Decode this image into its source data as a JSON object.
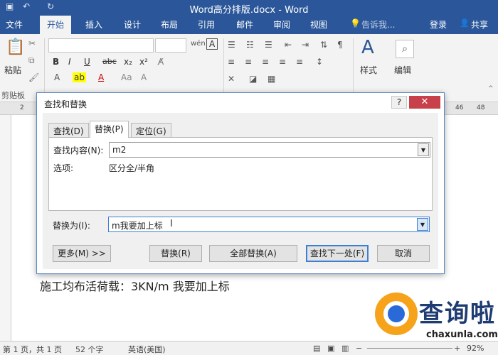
{
  "window": {
    "title": "Word高分排版.docx - Word"
  },
  "ribbon": {
    "tabs": [
      "文件",
      "开始",
      "插入",
      "设计",
      "布局",
      "引用",
      "邮件",
      "审阅",
      "视图"
    ],
    "tell_me": "告诉我...",
    "login": "登录",
    "share": "共享",
    "paste_label": "粘贴",
    "clipboard_label": "剪贴板",
    "styles_label": "样式",
    "editing_label": "编辑",
    "font_btns": [
      "B",
      "I",
      "U",
      "abc",
      "x₂",
      "x²",
      "A"
    ]
  },
  "ruler": {
    "left": "2",
    "right1": "46",
    "right2": "48"
  },
  "document": {
    "text": "施工均布活荷载：3KN/m 我要加上标"
  },
  "status": {
    "page": "第 1 页，共 1 页",
    "words": "52 个字",
    "language": "英语(美国)",
    "zoom": "92%"
  },
  "watermark": {
    "text": "查询啦",
    "url": "chaxunla.com"
  },
  "dialog": {
    "title": "查找和替换",
    "help": "?",
    "close": "✕",
    "tabs": [
      "查找(D)",
      "替换(P)",
      "定位(G)"
    ],
    "find_label": "查找内容(N):",
    "find_value": "m2",
    "options_label": "选项:",
    "options_value": "区分全/半角",
    "replace_label": "替换为(I):",
    "replace_value": "m我要加上标",
    "buttons": {
      "more": "更多(M) >>",
      "replace": "替换(R)",
      "replace_all": "全部替换(A)",
      "find_next": "查找下一处(F)",
      "cancel": "取消"
    }
  }
}
